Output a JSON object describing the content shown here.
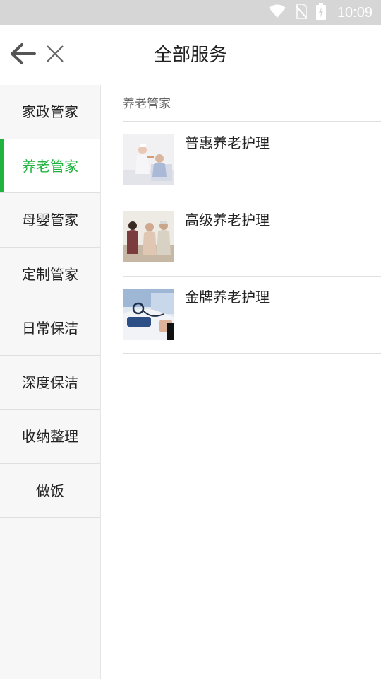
{
  "status_bar": {
    "time": "10:09",
    "icons": [
      "wifi-icon",
      "no-sim-icon",
      "battery-charging-icon"
    ]
  },
  "header": {
    "title": "全部服务",
    "back_icon": "arrow-left-icon",
    "close_icon": "close-icon"
  },
  "sidebar": {
    "items": [
      {
        "label": "家政管家",
        "active": false
      },
      {
        "label": "养老管家",
        "active": true
      },
      {
        "label": "母婴管家",
        "active": false
      },
      {
        "label": "定制管家",
        "active": false
      },
      {
        "label": "日常保洁",
        "active": false
      },
      {
        "label": "深度保洁",
        "active": false
      },
      {
        "label": "收纳整理",
        "active": false
      },
      {
        "label": "做饭",
        "active": false
      }
    ]
  },
  "content": {
    "section_title": "养老管家",
    "services": [
      {
        "name": "普惠养老护理",
        "image": "caregiver-feeding-elder-photo"
      },
      {
        "name": "高级养老护理",
        "image": "family-with-elderly-couple-photo"
      },
      {
        "name": "金牌养老护理",
        "image": "blood-pressure-measurement-photo"
      }
    ]
  },
  "colors": {
    "accent": "#21b33f",
    "status_bar": "#d6d6d6",
    "sidebar_bg": "#f7f7f7"
  }
}
